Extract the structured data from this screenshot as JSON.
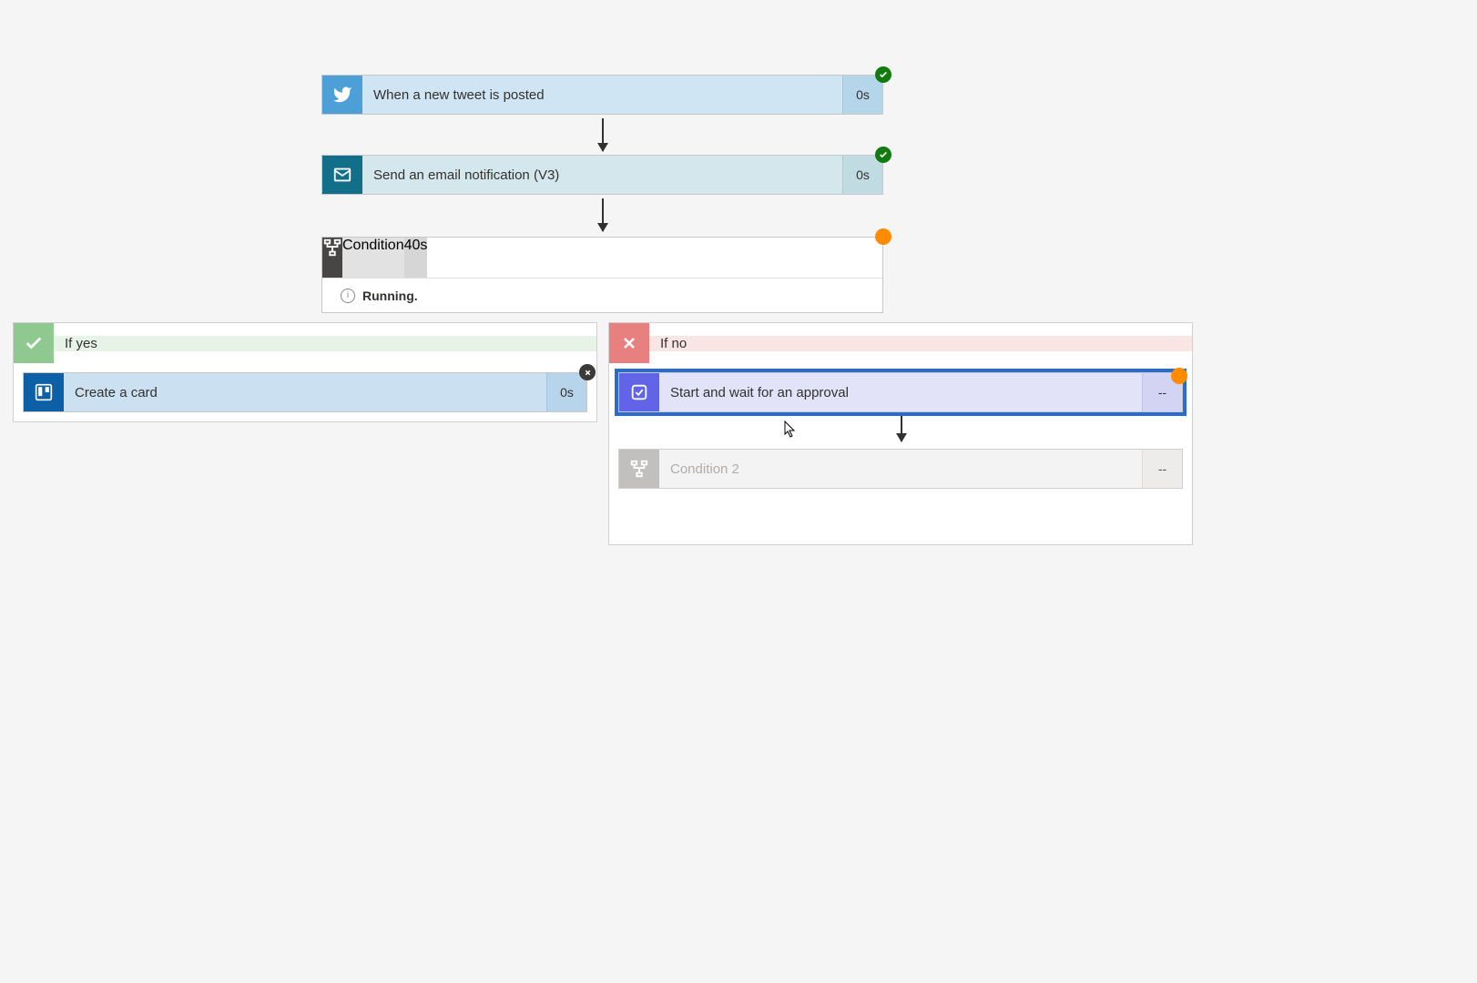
{
  "steps": {
    "trigger": {
      "label": "When a new tweet is posted",
      "duration": "0s",
      "status": "success"
    },
    "email": {
      "label": "Send an email notification (V3)",
      "duration": "0s",
      "status": "success"
    },
    "condition": {
      "label": "Condition",
      "duration": "40s",
      "status": "running",
      "status_text": "Running."
    }
  },
  "branches": {
    "yes": {
      "label": "If yes",
      "steps": {
        "trello": {
          "label": "Create a card",
          "duration": "0s",
          "status": "error"
        }
      }
    },
    "no": {
      "label": "If no",
      "steps": {
        "approval": {
          "label": "Start and wait for an approval",
          "duration": "--",
          "status": "running"
        },
        "condition2": {
          "label": "Condition 2",
          "duration": "--"
        }
      }
    }
  }
}
